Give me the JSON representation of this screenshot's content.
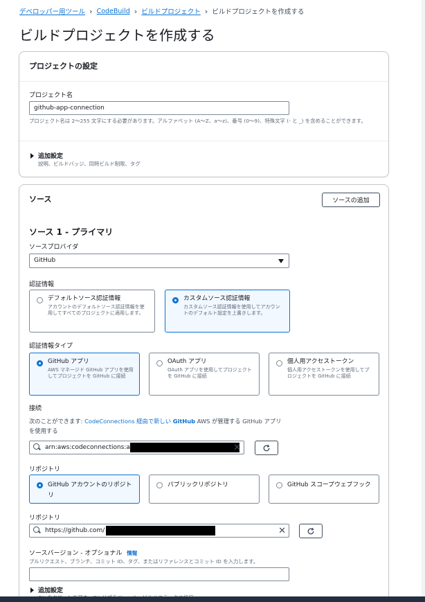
{
  "breadcrumb": {
    "items": [
      "デベロッパー用ツール",
      "CodeBuild",
      "ビルドプロジェクト"
    ],
    "current": "ビルドプロジェクトを作成する"
  },
  "page_title": "ビルドプロジェクトを作成する",
  "project_settings": {
    "header": "プロジェクトの設定",
    "name_label": "プロジェクト名",
    "name_value": "github-app-connection",
    "name_help": "プロジェクト名は 2〜255 文字にする必要があります。アルファベット (A〜Z、a〜z)、番号 (0〜9)、特殊文字 (- と _) を含めることができます。",
    "additional_title": "追加設定",
    "additional_desc": "説明、ビルドバッジ、同時ビルド制限、タグ"
  },
  "source": {
    "header": "ソース",
    "add_button": "ソースの追加",
    "primary_title": "ソース 1 - プライマリ",
    "provider_label": "ソースプロバイダ",
    "provider_value": "GitHub",
    "credential_label": "認証情報",
    "credential_options": [
      {
        "title": "デフォルトソース認証情報",
        "desc": "アカウントのデフォルトソース認証情報を使用してすべてのプロジェクトに適用します。"
      },
      {
        "title": "カスタムソース認証情報",
        "desc": "カスタムソース認証情報を使用してアカウントのデフォルト設定を上書きします。"
      }
    ],
    "credential_type_label": "認証情報タイプ",
    "credential_types": [
      {
        "title": "GitHub アプリ",
        "desc": "AWS マネージド GitHub アプリを使用してプロジェクトを GitHub に接続"
      },
      {
        "title": "OAuth アプリ",
        "desc": "OAuth アプリを使用してプロジェクトを GitHub に接続"
      },
      {
        "title": "個人用アクセストークン",
        "desc": "個人用アクセストークンを使用してプロジェクトを GitHub に接続"
      }
    ],
    "connection_label": "接続",
    "connection_help_prefix": "次のことができます: ",
    "connection_help_link": "CodeConnections",
    "connection_help_mid": " 経由で新しい ",
    "connection_help_bold": "GitHub",
    "connection_help_suffix": " AWS が管理する GitHub アプリを使用する",
    "connection_value": "arn:aws:codeconnections:a",
    "repository_label": "リポジトリ",
    "repository_options": [
      {
        "title": "GitHub アカウントのリポジトリ"
      },
      {
        "title": "パブリックリポジトリ"
      },
      {
        "title": "GitHub スコープウェブフック"
      }
    ],
    "repo_url_label": "リポジトリ",
    "repo_url_value": "https://github.com/",
    "version_label": "ソースバージョン - オプショナル",
    "version_info": "情報",
    "version_help": "プルリクエスト、ブランチ、コミット ID、タグ、またはリファレンスとコミット ID を入力します。",
    "additional_title": "追加設定",
    "additional_desc": "Git のクローンの深さ、Git サブモジュール、ビルドステータス設定"
  }
}
